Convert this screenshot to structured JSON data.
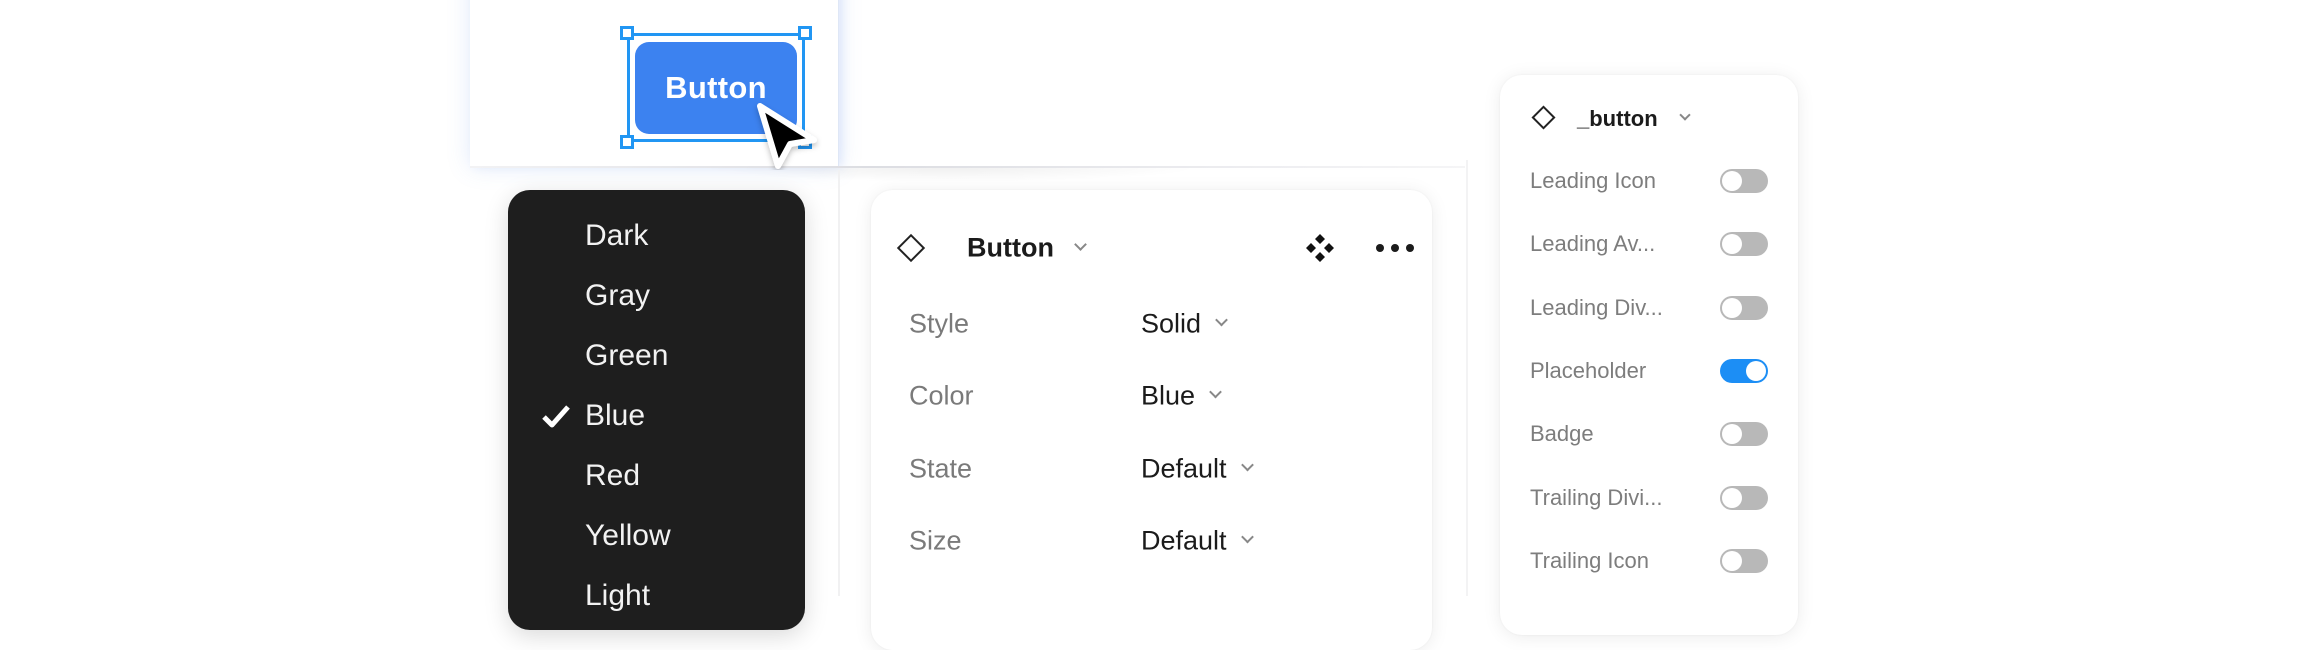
{
  "canvas": {
    "button_label": "Button",
    "button_color": "#3c82f0",
    "selection_color": "#2196f3"
  },
  "dropdown": {
    "items": [
      {
        "label": "Dark",
        "selected": false
      },
      {
        "label": "Gray",
        "selected": false
      },
      {
        "label": "Green",
        "selected": false
      },
      {
        "label": "Blue",
        "selected": true
      },
      {
        "label": "Red",
        "selected": false
      },
      {
        "label": "Yellow",
        "selected": false
      },
      {
        "label": "Light",
        "selected": false
      }
    ]
  },
  "component_panel": {
    "title": "Button",
    "icons": {
      "component": "component-set-icon",
      "more": "more-icon",
      "type": "diamond-icon"
    },
    "properties": [
      {
        "label": "Style",
        "value": "Solid"
      },
      {
        "label": "Color",
        "value": "Blue"
      },
      {
        "label": "State",
        "value": "Default"
      },
      {
        "label": "Size",
        "value": "Default"
      }
    ]
  },
  "instance_panel": {
    "title": "_button",
    "toggle_on_color": "#1c8ef5",
    "toggles": [
      {
        "label": "Leading Icon",
        "on": false
      },
      {
        "label": "Leading Av...",
        "on": false
      },
      {
        "label": "Leading Div...",
        "on": false
      },
      {
        "label": "Placeholder",
        "on": true
      },
      {
        "label": "Badge",
        "on": false
      },
      {
        "label": "Trailing Divi...",
        "on": false
      },
      {
        "label": "Trailing Icon",
        "on": false
      }
    ]
  }
}
